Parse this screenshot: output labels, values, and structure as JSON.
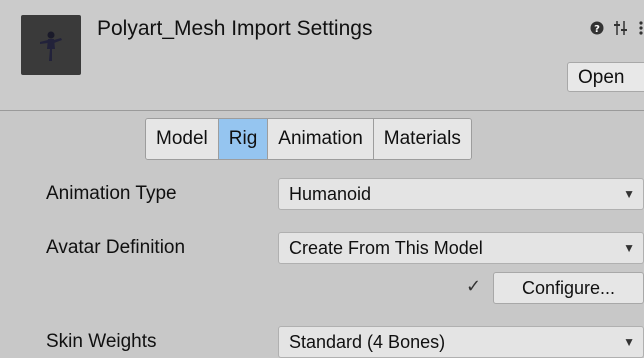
{
  "header": {
    "title": "Polyart_Mesh Import Settings",
    "open_label": "Open",
    "icons": [
      "help-icon",
      "preset-sliders-icon",
      "more-options-icon"
    ]
  },
  "tabs": [
    {
      "label": "Model",
      "active": false
    },
    {
      "label": "Rig",
      "active": true
    },
    {
      "label": "Animation",
      "active": false
    },
    {
      "label": "Materials",
      "active": false
    }
  ],
  "fields": {
    "animation_type": {
      "label": "Animation Type",
      "value": "Humanoid"
    },
    "avatar_definition": {
      "label": "Avatar Definition",
      "value": "Create From This Model"
    },
    "configure_label": "Configure...",
    "skin_weights": {
      "label": "Skin Weights",
      "value": "Standard (4 Bones)"
    }
  },
  "colors": {
    "active_tab": "#95c5f0",
    "background": "#c8c8c8"
  }
}
